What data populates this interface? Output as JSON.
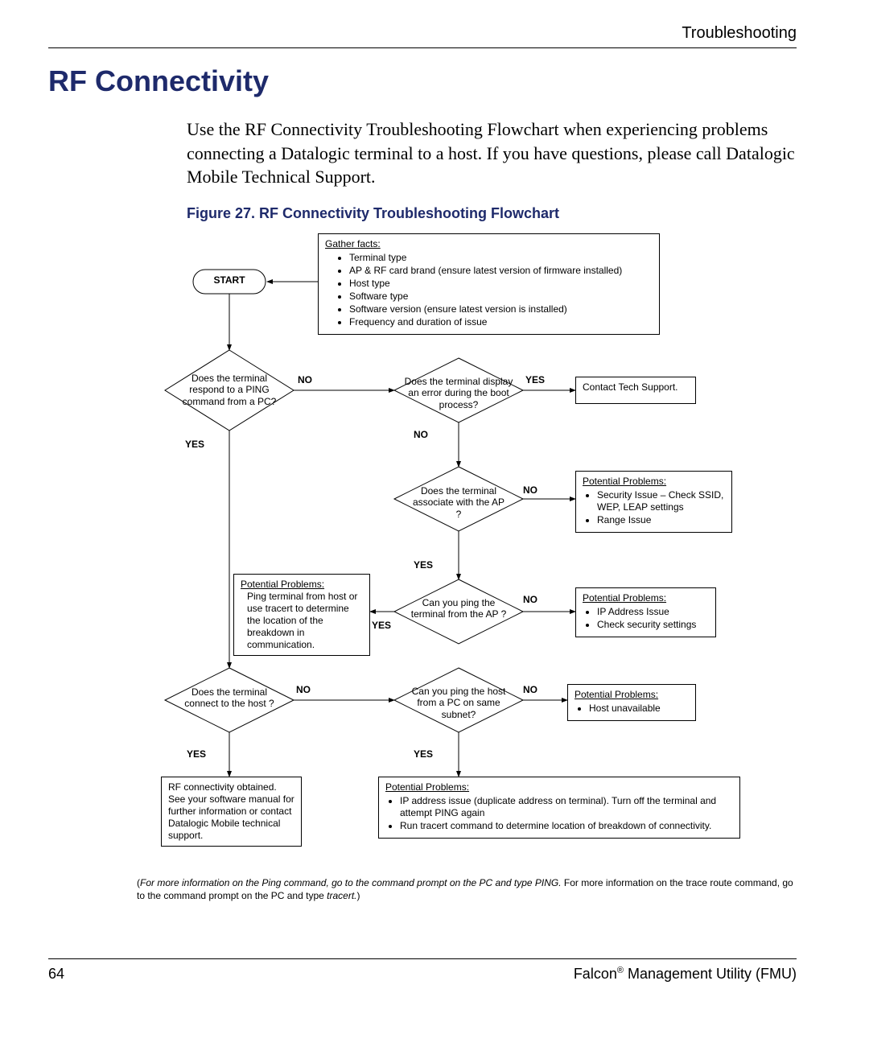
{
  "header": {
    "section": "Troubleshooting"
  },
  "title": "RF Connectivity",
  "intro": "Use the RF Connectivity Troubleshooting Flowchart when experiencing problems connecting a Datalogic terminal to a host. If you have questions, please call Datalogic Mobile Technical Support.",
  "figure_caption": "Figure 27. RF Connectivity Troubleshooting Flowchart",
  "chart_data": {
    "type": "flowchart",
    "nodes": [
      {
        "id": "start",
        "type": "terminator",
        "text": "START"
      },
      {
        "id": "facts",
        "type": "process",
        "text": "Gather facts:",
        "items": [
          "Terminal type",
          "AP & RF card brand (ensure latest version of firmware installed)",
          "Host type",
          "Software type",
          "Software version (ensure latest version is installed)",
          "Frequency and duration of issue"
        ]
      },
      {
        "id": "d1",
        "type": "decision",
        "text": "Does the terminal respond to a PING command from a PC?"
      },
      {
        "id": "d2",
        "type": "decision",
        "text": "Does the terminal display an error during the boot process?"
      },
      {
        "id": "contact",
        "type": "process",
        "text": "Contact Tech Support."
      },
      {
        "id": "d3",
        "type": "decision",
        "text": "Does the terminal associate with the AP ?"
      },
      {
        "id": "p1",
        "type": "process",
        "text": "Potential Problems:",
        "items": [
          "Security Issue – Check SSID, WEP, LEAP settings",
          "Range Issue"
        ]
      },
      {
        "id": "p2",
        "type": "process",
        "text": "Potential Problems:",
        "items": [
          "Ping terminal from host or use tracert to determine the location of the breakdown in communication."
        ]
      },
      {
        "id": "d4",
        "type": "decision",
        "text": "Can you ping the terminal from the AP ?"
      },
      {
        "id": "p3",
        "type": "process",
        "text": "Potential Problems:",
        "items": [
          "IP Address Issue",
          "Check security settings"
        ]
      },
      {
        "id": "d5",
        "type": "decision",
        "text": "Does the terminal connect to the host ?"
      },
      {
        "id": "d6",
        "type": "decision",
        "text": "Can you ping the host from a PC on same subnet?"
      },
      {
        "id": "p4",
        "type": "process",
        "text": "Potential Problems:",
        "items": [
          "Host unavailable"
        ]
      },
      {
        "id": "end",
        "type": "process",
        "text": "RF connectivity obtained. See your software manual for further information or contact Datalogic Mobile technical support."
      },
      {
        "id": "p5",
        "type": "process",
        "text": "Potential Problems:",
        "items": [
          "IP address issue (duplicate address on terminal). Turn off the terminal and attempt PING again",
          "Run tracert command to determine location of breakdown of connectivity."
        ]
      }
    ],
    "edges": [
      {
        "from": "start",
        "to": "facts"
      },
      {
        "from": "start",
        "to": "d1"
      },
      {
        "from": "d1",
        "to": "d2",
        "label": "NO"
      },
      {
        "from": "d1",
        "to": "d5",
        "label": "YES"
      },
      {
        "from": "d2",
        "to": "contact",
        "label": "YES"
      },
      {
        "from": "d2",
        "to": "d3",
        "label": "NO"
      },
      {
        "from": "d3",
        "to": "p1",
        "label": "NO"
      },
      {
        "from": "d3",
        "to": "d4",
        "label": "YES"
      },
      {
        "from": "d4",
        "to": "p2",
        "label": "YES"
      },
      {
        "from": "d4",
        "to": "p3",
        "label": "NO"
      },
      {
        "from": "d5",
        "to": "d6",
        "label": "NO"
      },
      {
        "from": "d5",
        "to": "end",
        "label": "YES"
      },
      {
        "from": "d6",
        "to": "p4",
        "label": "NO"
      },
      {
        "from": "d6",
        "to": "p5",
        "label": "YES"
      }
    ]
  },
  "footnote_italic1": "For more information on the Ping command, go to the command prompt on the PC and type PING.",
  "footnote_plain": " For more information on the trace route command, go to the command prompt on the PC and type ",
  "footnote_italic2": "tracert.",
  "footer": {
    "page": "64",
    "product_left": "Falcon",
    "product_right": " Management Utility (FMU)"
  }
}
